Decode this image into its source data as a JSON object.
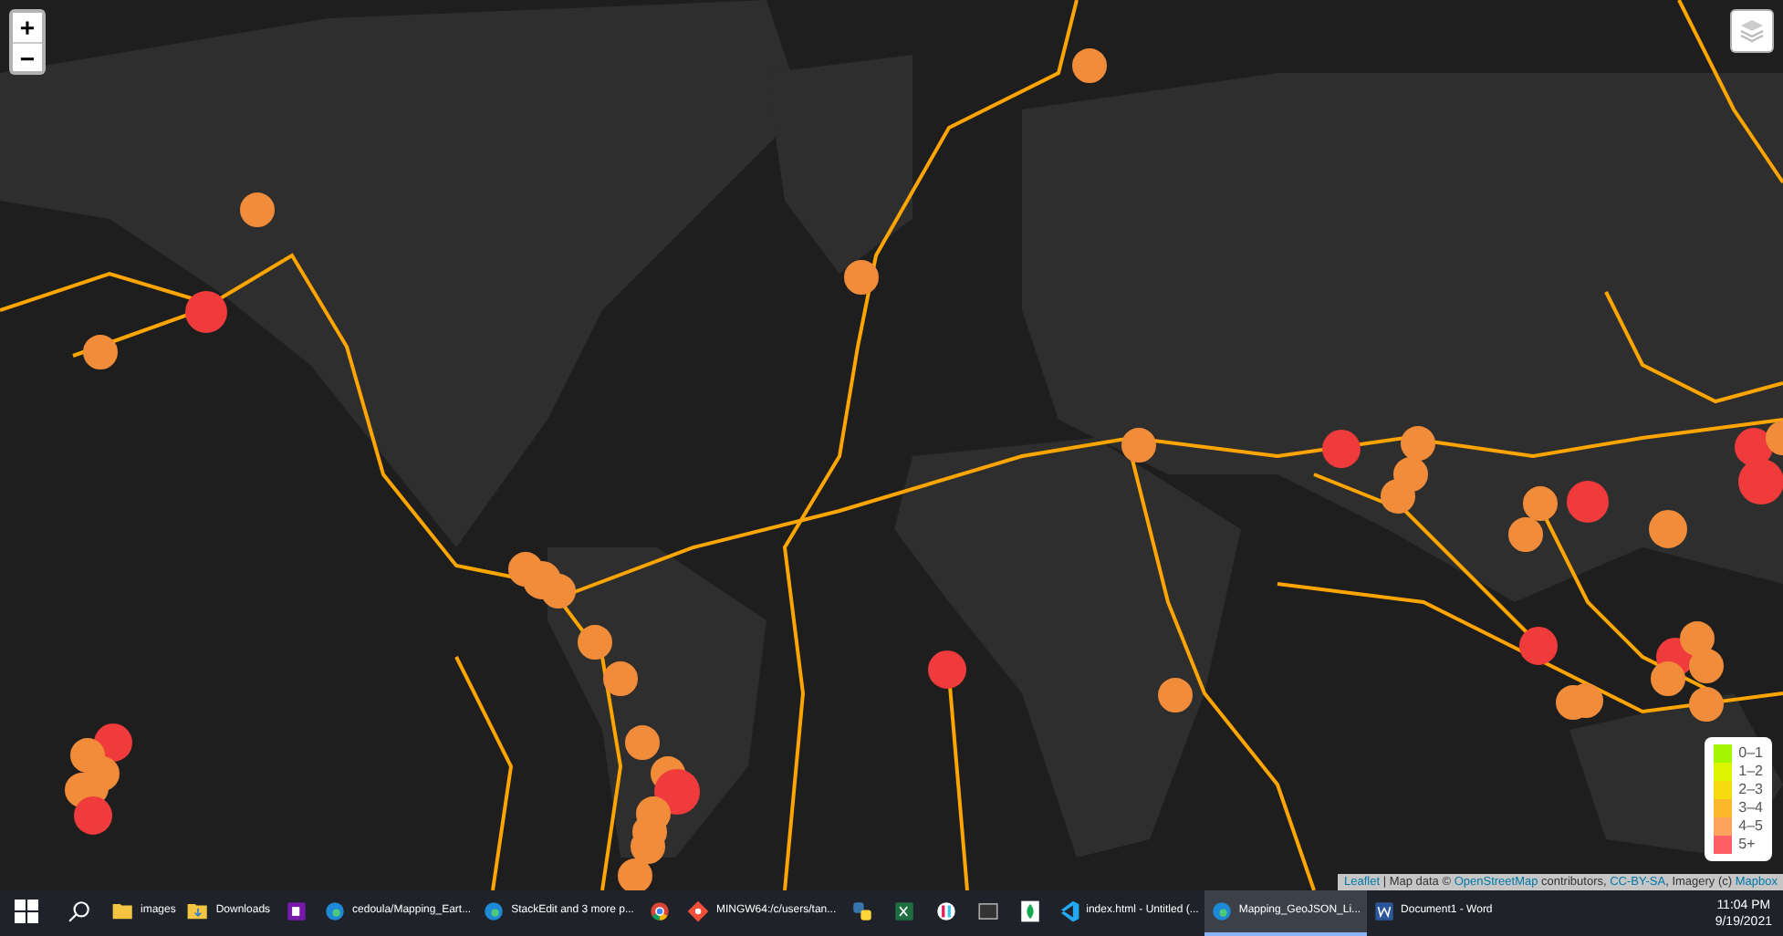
{
  "map": {
    "zoom_in": "+",
    "zoom_out": "−",
    "legend": [
      {
        "label": "0–1",
        "color": "#a3f600"
      },
      {
        "label": "1–2",
        "color": "#dcf400"
      },
      {
        "label": "2–3",
        "color": "#f7db11"
      },
      {
        "label": "3–4",
        "color": "#fdb72a"
      },
      {
        "label": "4–5",
        "color": "#fca35d"
      },
      {
        "label": "5+",
        "color": "#ff5f65"
      }
    ],
    "attribution": [
      {
        "kind": "link",
        "text": "Leaflet"
      },
      {
        "kind": "text",
        "text": " | Map data © "
      },
      {
        "kind": "link",
        "text": "OpenStreetMap"
      },
      {
        "kind": "text",
        "text": " contributors, "
      },
      {
        "kind": "link",
        "text": "CC-BY-SA"
      },
      {
        "kind": "text",
        "text": ", Imagery (c) "
      },
      {
        "kind": "link",
        "text": "Mapbox"
      }
    ]
  },
  "taskbar": {
    "items": [
      {
        "kind": "folder",
        "label": "images",
        "selected": false
      },
      {
        "kind": "downloads",
        "label": "Downloads",
        "selected": false
      },
      {
        "kind": "onenote",
        "selected": false
      },
      {
        "kind": "edge",
        "label": "cedoula/Mapping_Eart...",
        "selected": false
      },
      {
        "kind": "edge",
        "label": "StackEdit and 3 more p...",
        "selected": false
      },
      {
        "kind": "chrome",
        "selected": false
      },
      {
        "kind": "git",
        "label": "MINGW64:/c/users/tan...",
        "selected": false
      },
      {
        "kind": "python",
        "selected": false
      },
      {
        "kind": "excel",
        "selected": false
      },
      {
        "kind": "slack",
        "selected": false
      },
      {
        "kind": "terminal",
        "selected": false
      },
      {
        "kind": "leaf",
        "selected": false
      },
      {
        "kind": "vscode",
        "label": "index.html - Untitled (...",
        "selected": false
      },
      {
        "kind": "edge",
        "label": "Mapping_GeoJSON_Li...",
        "selected": true
      },
      {
        "kind": "word",
        "label": "Document1 - Word",
        "selected": false
      }
    ],
    "time": "11:04 PM",
    "date": "9/19/2021"
  }
}
